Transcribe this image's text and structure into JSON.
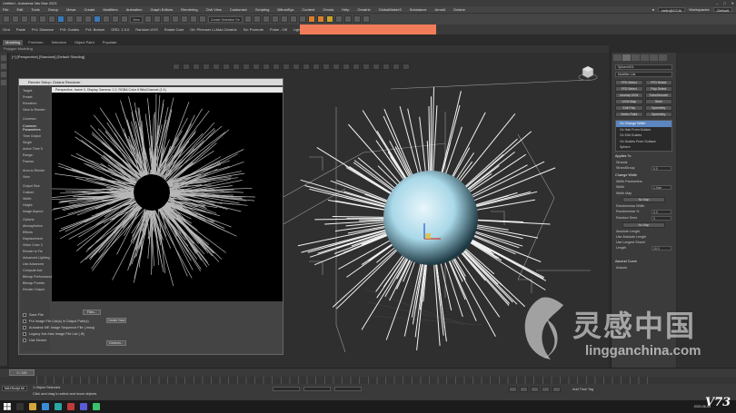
{
  "app": {
    "title": "Untitled - Autodesk 3ds Max 2021"
  },
  "menu": {
    "items": [
      "File",
      "Edit",
      "Tools",
      "Group",
      "Views",
      "Create",
      "Modifiers",
      "Animation",
      "Graph Editors",
      "Rendering",
      "Civil View",
      "Customize",
      "Scripting",
      "BifrostSys",
      "Content",
      "Omnia",
      "Help",
      "Ornatrix",
      "GlobalMaker3",
      "Substance",
      "Arnold",
      "Octane"
    ],
    "sign_in": "hello@CCAI",
    "workspaces_label": "Workspaces:",
    "workspace_value": "Default"
  },
  "toolbar": {
    "view_dropdown": "View",
    "selection_set": "Create Selection Se"
  },
  "toolbar2": {
    "items": [
      "Ornt",
      "Paste",
      "Pr1: Distance",
      "Pr3: Guides",
      "Pr3: Bottom",
      "GRD: 1.0.0",
      "Random UVS",
      "Rotate Cam",
      "Ori: Plexuser Li-Max.Ornatrix",
      "Sa: Promote",
      "Pulse - Off",
      "Light Setter"
    ],
    "banner_text": ""
  },
  "ribbon": {
    "tabs": [
      "Modeling",
      "Freeform",
      "Selection",
      "Object Paint",
      "Populate"
    ],
    "active_tab": "Modeling",
    "row_label": "Polygon Modeling"
  },
  "viewport": {
    "label": "[+] [Perspective] [Standard] [Default Shading]"
  },
  "render_window": {
    "title": "Render Setup: Octane Renderer",
    "frame_title": "Perspective, frame 0, Display Gamma: 2.2, RGBA Color 8 Bits/Channel (1:1)",
    "panel_rows": [
      "Target:",
      "Preset:",
      "Renderer:",
      "View to Render:"
    ],
    "common_header": "Common",
    "common_params": "Common Parameters",
    "time_output": "Time Output",
    "options": [
      "Single",
      "Active Time S",
      "Range:",
      "Frames"
    ],
    "area_label": "Area to Render",
    "area_value": "View",
    "output_size": "Output Size",
    "output_custom": "Custom",
    "width_label": "Width:",
    "height_label": "Height:",
    "aspect_label": "Image Aspect:",
    "options_header": "Options",
    "opt_items": [
      "Atmospherics",
      "Effects",
      "Displacement",
      "Video Color C",
      "Render to Fie"
    ],
    "adv_lighting": "Advanced Lighting",
    "adv_items": [
      "Use Advanced",
      "Compute Adv"
    ],
    "bitmap_perf": "Bitmap Performance",
    "bitmap_proxies": "Bitmap Proxies",
    "render_output": "Render Output",
    "save_file": "Save File",
    "files_btn": "Files...",
    "put_image": "Put Image File List(s) in Output Path(s)",
    "create_now": "Create Now",
    "autodesk_seq": "Autodesk ME Image Sequence File (.imsq)",
    "legacy_seq": "Legacy 3ds Max Image File List (.ifl)",
    "use_device": "Use Device",
    "devices_btn": "Devices..."
  },
  "command_panel": {
    "object_name": "Sphere001",
    "modifier_list": "Modifier List",
    "buttons": [
      "FFD Select",
      "FFD Select",
      "FFD Select",
      "Poly Select",
      "Unwrap UVW",
      "TurboSmooth",
      "UVW Map",
      "Shell",
      "Edit Poly",
      "Symmetry",
      "Vertex Paint",
      "Symmetry"
    ],
    "stack": [
      {
        "label": "Ox Change Width",
        "selected": true
      },
      {
        "label": "Ox Hair From Guides",
        "selected": false
      },
      {
        "label": "Ox Edit Guides",
        "selected": false
      },
      {
        "label": "Ox Guides From Surface",
        "selected": false
      },
      {
        "label": "Sphere",
        "selected": false
      }
    ],
    "applies_to": "Applies To",
    "strands": "Strands",
    "strand_group": "StrandGroup",
    "strand_group_value": "0.0",
    "change_width": "Change Width",
    "width_params": "Width Parameters",
    "width_label": "Width",
    "width_value": "1.0cm",
    "width_map_label": "Width Map",
    "no_map": "No Map",
    "randomness": "Randomness Width",
    "randomness_pct": "Randomness %",
    "randomness_pct_value": "0.0",
    "random_seed": "Random Seed",
    "random_seed_value": "0",
    "absolute_length": "Absolute Length",
    "use_abs_length": "Use Absolute Length",
    "use_longest": "Use Longest Strand",
    "length_label": "Length",
    "length_value": "10.0",
    "ascend_curve": "Ascend Curve",
    "artwork": "Artwork"
  },
  "timeline": {
    "frame": "0 / 100"
  },
  "status": {
    "maxscript": "MAXScript Mi",
    "selected": "1 Object Selected",
    "prompt": "Click and drag to select and move objects",
    "add_time_tag": "Add Time Tag"
  },
  "taskbar": {
    "time": "2020-06-04"
  },
  "watermark": {
    "chinese": "灵感中国",
    "url": "lingganchina.com"
  },
  "corner_logo": "V73"
}
